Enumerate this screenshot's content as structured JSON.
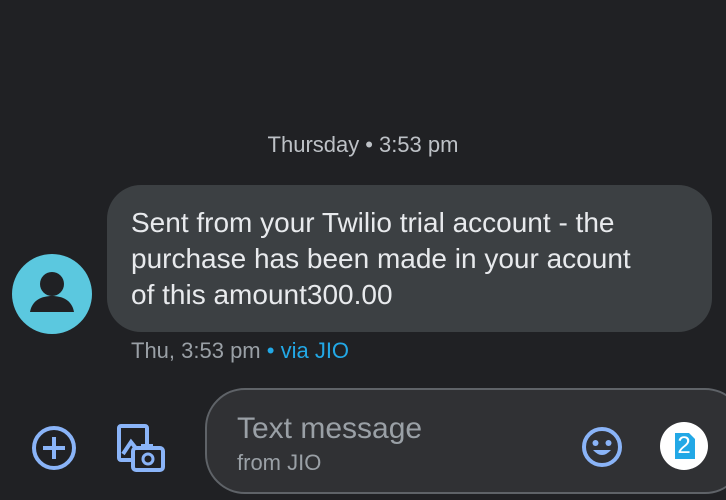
{
  "conversation": {
    "date_day": "Thursday",
    "date_separator": "•",
    "date_time": "3:53 pm"
  },
  "message": {
    "text": "Sent from your Twilio trial account - the\npurchase has been made in your acount\nof this amount300.00",
    "timestamp": "Thu, 3:53 pm",
    "via": "• via JIO",
    "sender_avatar_icon": "person-icon",
    "avatar_color": "#5bc8df"
  },
  "composer": {
    "placeholder": "Text message",
    "sim_hint": "from JIO",
    "sim_number": "2",
    "icons": [
      "add-circle-icon",
      "gallery-camera-icon",
      "emoji-icon",
      "sim-card-icon"
    ],
    "accent_color": "#8ab4f8"
  }
}
